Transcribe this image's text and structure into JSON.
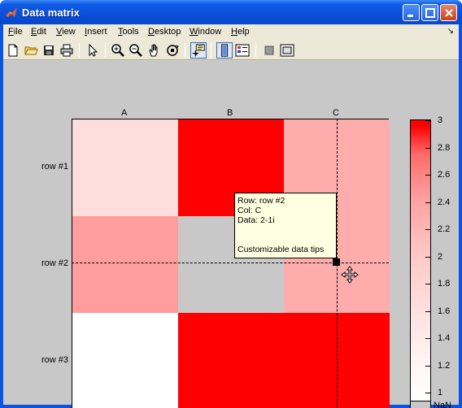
{
  "window": {
    "title": "Data matrix",
    "accent": "#0a54e0"
  },
  "menu": {
    "items": [
      {
        "key": "F",
        "rest": "ile"
      },
      {
        "key": "E",
        "rest": "dit"
      },
      {
        "key": "V",
        "rest": "iew"
      },
      {
        "key": "I",
        "rest": "nsert"
      },
      {
        "key": "T",
        "rest": "ools"
      },
      {
        "key": "D",
        "rest": "esktop"
      },
      {
        "key": "W",
        "rest": "indow"
      },
      {
        "key": "H",
        "rest": "elp"
      }
    ],
    "overflow_arrow": "↘"
  },
  "toolbar": {
    "buttons": [
      "new-file-icon",
      "open-folder-icon",
      "save-icon",
      "print-icon",
      "pointer-icon",
      "zoom-in-icon",
      "zoom-out-icon",
      "pan-hand-icon",
      "rotate-3d-icon",
      "data-cursor-icon",
      "colorbar-icon",
      "legend-icon",
      "hide-plot-tools-icon",
      "show-plot-tools-icon"
    ]
  },
  "chart_data": {
    "type": "heatmap",
    "columns": [
      "A",
      "B",
      "C"
    ],
    "rows": [
      "row #1",
      "row #2",
      "row #3"
    ],
    "values": [
      [
        1.8,
        3,
        2.2
      ],
      [
        2.3,
        null,
        2.2
      ],
      [
        1.0,
        3,
        3
      ]
    ],
    "colorbar": {
      "ticks": [
        "3",
        "2.8",
        "2.6",
        "2.4",
        "2.2",
        "2",
        "1.8",
        "1.6",
        "1.4",
        "1.2",
        "1"
      ],
      "nan_label": "NaN",
      "range": [
        1,
        3
      ]
    },
    "nan_color": "#c8c8c8",
    "max_color": "#ff0000",
    "min_color": "#ffffff"
  },
  "datatip": {
    "row": "Row: row #2",
    "col": "Col: C",
    "data": "Data: 2-1i",
    "note": "Customizable data tips"
  }
}
